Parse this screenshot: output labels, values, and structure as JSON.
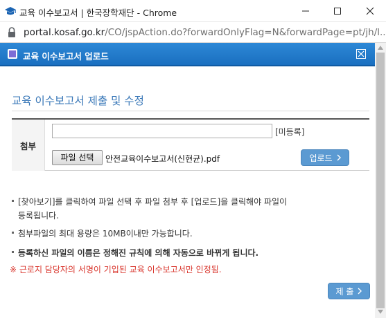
{
  "window": {
    "title": "교육 이수보고서 | 한국장학재단 - Chrome"
  },
  "address_bar": {
    "host": "portal.kosaf.go.kr",
    "path": "/CO/jspAction.do?forwardOnlyFlag=N&forwardPage=pt/jh/l..."
  },
  "dialog": {
    "title": "교육 이수보고서 업로드",
    "section_title": "교육 이수보고서 제출 및 수정",
    "form": {
      "row_label": "첨부",
      "file_path_value": "",
      "status_label": "[미등록]",
      "choose_file_label": "파일 선택",
      "chosen_file_name": "안전교육이수보고서(신현균).pdf",
      "upload_label": "업로드"
    },
    "notes": {
      "note1_line1": "[찾아보기]를 클릭하여 파일 선택 후 파일 첨부 후 [업로드]을 클릭해야 파일이",
      "note1_line2": "등록됩니다.",
      "note2": "첨부파일의 최대 용량은 10MB이내만 가능합니다.",
      "note3": "등록하신 파일의 이름은 정해진 규칙에 의해 자동으로 바뀌게 됩니다.",
      "warning": "※ 근로지 담당자의 서명이 기입된 교육 이수보고서만 인정됨."
    },
    "submit_label": "제 출"
  },
  "colors": {
    "header_blue": "#1a6fc0",
    "button_blue": "#5b9ad2",
    "section_title": "#3a78b8",
    "warning_red": "#d9362d"
  },
  "icons": {
    "app": "graduation-cap-icon",
    "lock": "lock-icon",
    "dialog": "window-icon",
    "close": "close-icon",
    "chevron": "chevron-right-icon"
  }
}
